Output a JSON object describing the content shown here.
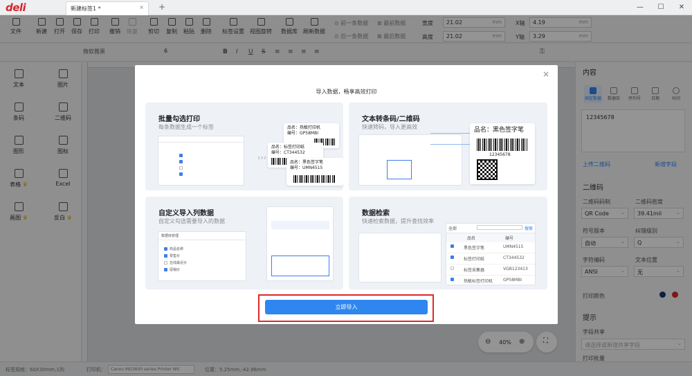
{
  "app": {
    "logo": "deli",
    "doc_tab": "新建标签1 *",
    "tab_close": "×",
    "tab_add": "+"
  },
  "toolbar": {
    "items": [
      "文件",
      "新建",
      "打开",
      "保存",
      "打印",
      "撤销",
      "恢复",
      "剪切",
      "复制",
      "粘贴",
      "删除",
      "标签设置",
      "视图旋转",
      "数据库",
      "刷新数据"
    ],
    "nav": {
      "prev": "前一条数据",
      "first": "最前数据",
      "next": "后一条数据",
      "last": "最后数据"
    },
    "width_label": "宽度",
    "width_value": "21.02",
    "height_label": "高度",
    "height_value": "21.02",
    "unit": "mm",
    "x_label": "X轴",
    "x_value": "4.19",
    "y_label": "Y轴",
    "y_value": "3.29"
  },
  "format": {
    "font_family": "微软雅黑",
    "font_size": "6"
  },
  "left_tools": [
    {
      "label": "文本"
    },
    {
      "label": "图片"
    },
    {
      "label": "条码"
    },
    {
      "label": "二维码"
    },
    {
      "label": "图形"
    },
    {
      "label": "图标"
    },
    {
      "label": "表格"
    },
    {
      "label": "Excel"
    },
    {
      "label": "画图"
    },
    {
      "label": "反白"
    }
  ],
  "right": {
    "section_title": "内容",
    "tabs": [
      "固定数据",
      "数据库",
      "序列号",
      "日期",
      "时间"
    ],
    "content_value": "12345678",
    "upload_link": "上传二维码",
    "add_field_link": "新增字段",
    "qr_title": "二维码",
    "qr_type_label": "二维码码制",
    "qr_type": "QR Code",
    "qr_density_label": "二维码密度",
    "qr_density": "39.41mil",
    "version_label": "符号版本",
    "version": "自动",
    "ecc_label": "纠错级别",
    "ecc": "Q",
    "charset_label": "字符编码",
    "charset": "ANSI",
    "text_pos_label": "文本位置",
    "text_pos": "无",
    "print_color_label": "打印颜色",
    "hint_title": "提示",
    "share_label": "字段共享",
    "share_placeholder": "请选择或新增共享字段",
    "batch_label": "打印批量"
  },
  "statusbar": {
    "label_spec": "标签规格：60X30mm,1列",
    "printer_label": "打印机：",
    "printer": "Canon MG3600 series Printer WS",
    "position": "位置：5.25mm,-42.96mm"
  },
  "zoom": {
    "value": "40%"
  },
  "modal": {
    "close": "×",
    "title": "导入数据，畅享高效打印",
    "cards": [
      {
        "title": "批量勾选打印",
        "subtitle": "每条数据生成一个标签"
      },
      {
        "title": "文本转条码/二维码",
        "subtitle": "快速转码，导入更高效"
      },
      {
        "title": "自定义导入列数据",
        "subtitle": "自定义勾选需要导入的数据"
      },
      {
        "title": "数据检索",
        "subtitle": "快速检索数据，提升查找效率"
      }
    ],
    "tags": [
      {
        "name": "品名：热敏打印机",
        "code": "编号：GP58MBI"
      },
      {
        "name": "品名：标签打印纸",
        "code": "编号：CT344532"
      },
      {
        "name": "品名：黑色签字笔",
        "code": "编号：UMN4515"
      }
    ],
    "big_tag": {
      "name": "品名：黑色签字笔",
      "number": "12345678"
    },
    "search": {
      "header_name": "品名",
      "header_code": "编号",
      "filter": "全部",
      "button": "搜索",
      "rows": [
        {
          "name": "黑色签字笔",
          "code": "UMN4515",
          "checked": true
        },
        {
          "name": "标签打印纸",
          "code": "CT344532",
          "checked": true
        },
        {
          "name": "标签采集器",
          "code": "VGB123413",
          "checked": false
        },
        {
          "name": "热敏标签打印机",
          "code": "GP58MBI",
          "checked": true
        }
      ]
    },
    "column_mgr": {
      "title": "数据库管理",
      "items": [
        "商品名称",
        "零售价",
        "在线最近价",
        "促销价"
      ]
    },
    "import_button": "立即导入"
  }
}
